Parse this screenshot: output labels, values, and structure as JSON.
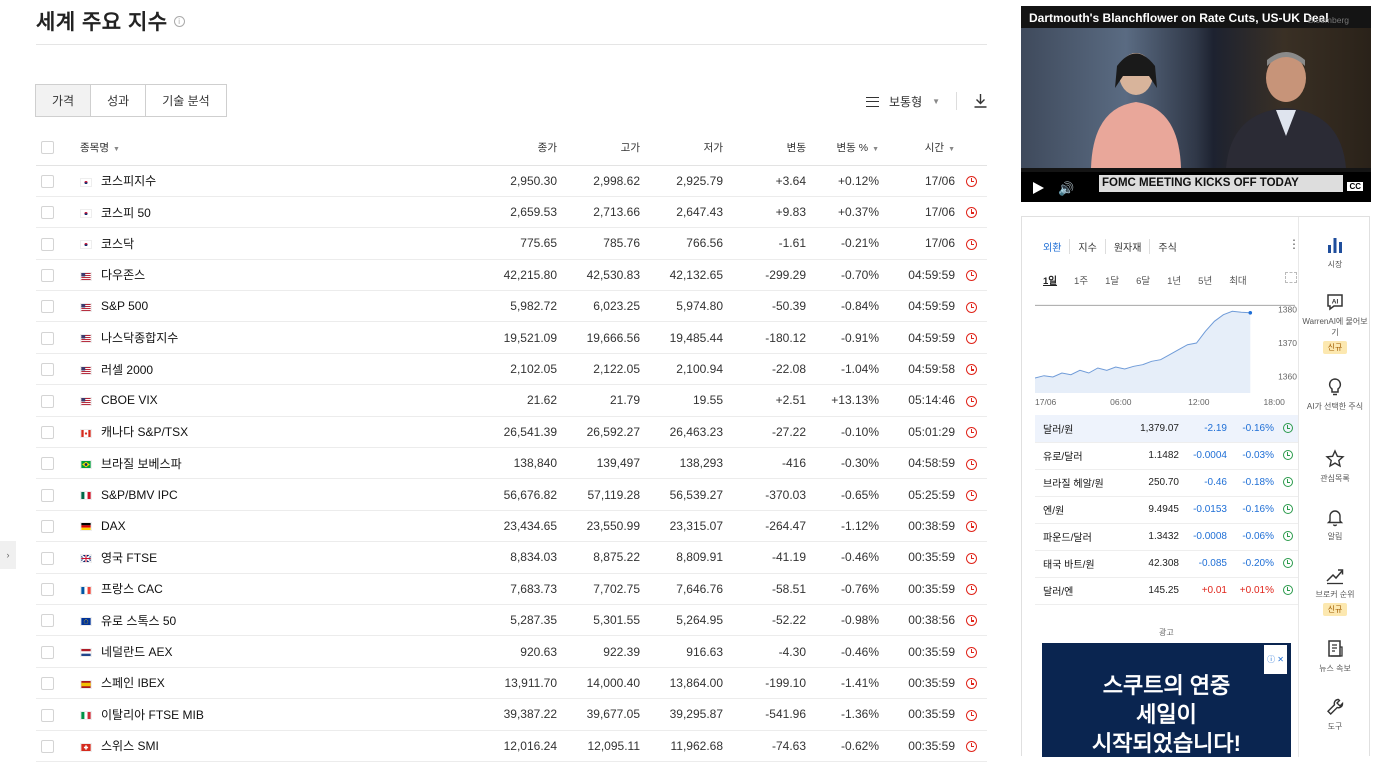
{
  "page_title": "세계 주요 지수",
  "tabs": [
    "가격",
    "성과",
    "기술 분석"
  ],
  "view_mode": "보통형",
  "columns": {
    "name": "종목명",
    "close": "종가",
    "high": "고가",
    "low": "저가",
    "change": "변동",
    "change_pct": "변동 %",
    "time": "시간"
  },
  "rows": [
    {
      "flag": "kr",
      "name": "코스피지수",
      "close": "2,950.30",
      "high": "2,998.62",
      "low": "2,925.79",
      "change": "+3.64",
      "change_pct": "+0.12%",
      "time": "17/06",
      "dir": "pos"
    },
    {
      "flag": "kr",
      "name": "코스피 50",
      "close": "2,659.53",
      "high": "2,713.66",
      "low": "2,647.43",
      "change": "+9.83",
      "change_pct": "+0.37%",
      "time": "17/06",
      "dir": "pos"
    },
    {
      "flag": "kr",
      "name": "코스닥",
      "close": "775.65",
      "high": "785.76",
      "low": "766.56",
      "change": "-1.61",
      "change_pct": "-0.21%",
      "time": "17/06",
      "dir": "neg"
    },
    {
      "flag": "us",
      "name": "다우존스",
      "close": "42,215.80",
      "high": "42,530.83",
      "low": "42,132.65",
      "change": "-299.29",
      "change_pct": "-0.70%",
      "time": "04:59:59",
      "dir": "neg"
    },
    {
      "flag": "us",
      "name": "S&P 500",
      "close": "5,982.72",
      "high": "6,023.25",
      "low": "5,974.80",
      "change": "-50.39",
      "change_pct": "-0.84%",
      "time": "04:59:59",
      "dir": "neg"
    },
    {
      "flag": "us",
      "name": "나스닥종합지수",
      "close": "19,521.09",
      "high": "19,666.56",
      "low": "19,485.44",
      "change": "-180.12",
      "change_pct": "-0.91%",
      "time": "04:59:59",
      "dir": "neg"
    },
    {
      "flag": "us",
      "name": "러셀 2000",
      "close": "2,102.05",
      "high": "2,122.05",
      "low": "2,100.94",
      "change": "-22.08",
      "change_pct": "-1.04%",
      "time": "04:59:58",
      "dir": "neg"
    },
    {
      "flag": "us",
      "name": "CBOE VIX",
      "close": "21.62",
      "high": "21.79",
      "low": "19.55",
      "change": "+2.51",
      "change_pct": "+13.13%",
      "time": "05:14:46",
      "dir": "pos"
    },
    {
      "flag": "ca",
      "name": "캐나다 S&P/TSX",
      "close": "26,541.39",
      "high": "26,592.27",
      "low": "26,463.23",
      "change": "-27.22",
      "change_pct": "-0.10%",
      "time": "05:01:29",
      "dir": "neg"
    },
    {
      "flag": "br",
      "name": "브라질 보베스파",
      "close": "138,840",
      "high": "139,497",
      "low": "138,293",
      "change": "-416",
      "change_pct": "-0.30%",
      "time": "04:58:59",
      "dir": "neg"
    },
    {
      "flag": "mx",
      "name": "S&P/BMV IPC",
      "close": "56,676.82",
      "high": "57,119.28",
      "low": "56,539.27",
      "change": "-370.03",
      "change_pct": "-0.65%",
      "time": "05:25:59",
      "dir": "neg"
    },
    {
      "flag": "de",
      "name": "DAX",
      "close": "23,434.65",
      "high": "23,550.99",
      "low": "23,315.07",
      "change": "-264.47",
      "change_pct": "-1.12%",
      "time": "00:38:59",
      "dir": "neg"
    },
    {
      "flag": "gb",
      "name": "영국 FTSE",
      "close": "8,834.03",
      "high": "8,875.22",
      "low": "8,809.91",
      "change": "-41.19",
      "change_pct": "-0.46%",
      "time": "00:35:59",
      "dir": "neg"
    },
    {
      "flag": "fr",
      "name": "프랑스 CAC",
      "close": "7,683.73",
      "high": "7,702.75",
      "low": "7,646.76",
      "change": "-58.51",
      "change_pct": "-0.76%",
      "time": "00:35:59",
      "dir": "neg"
    },
    {
      "flag": "eu",
      "name": "유로 스톡스 50",
      "close": "5,287.35",
      "high": "5,301.55",
      "low": "5,264.95",
      "change": "-52.22",
      "change_pct": "-0.98%",
      "time": "00:38:56",
      "dir": "neg"
    },
    {
      "flag": "nl",
      "name": "네덜란드 AEX",
      "close": "920.63",
      "high": "922.39",
      "low": "916.63",
      "change": "-4.30",
      "change_pct": "-0.46%",
      "time": "00:35:59",
      "dir": "neg"
    },
    {
      "flag": "es",
      "name": "스페인 IBEX",
      "close": "13,911.70",
      "high": "14,000.40",
      "low": "13,864.00",
      "change": "-199.10",
      "change_pct": "-1.41%",
      "time": "00:35:59",
      "dir": "neg"
    },
    {
      "flag": "it",
      "name": "이탈리아 FTSE MIB",
      "close": "39,387.22",
      "high": "39,677.05",
      "low": "39,295.87",
      "change": "-541.96",
      "change_pct": "-1.36%",
      "time": "00:35:59",
      "dir": "neg"
    },
    {
      "flag": "ch",
      "name": "스위스 SMI",
      "close": "12,016.24",
      "high": "12,095.11",
      "low": "11,962.68",
      "change": "-74.63",
      "change_pct": "-0.62%",
      "time": "00:35:59",
      "dir": "neg"
    }
  ],
  "video": {
    "title": "Dartmouth's Blanchflower on Rate Cuts, US-UK Deal",
    "brand": "Bloomberg",
    "ticker": "FOMC MEETING KICKS OFF TODAY",
    "cc": "CC"
  },
  "market_tabs": [
    "외환",
    "지수",
    "원자재",
    "주식"
  ],
  "periods": [
    "1일",
    "1주",
    "1달",
    "6달",
    "1년",
    "5년",
    "최대"
  ],
  "chart_data": {
    "type": "line",
    "x_ticks": [
      "17/06",
      "06:00",
      "12:00",
      "18:00"
    ],
    "y_ticks": [
      1360,
      1370,
      1380
    ],
    "ylim": [
      1355,
      1382
    ],
    "x": [
      0,
      1,
      2,
      3,
      4,
      5,
      6,
      7,
      8,
      9,
      10,
      11,
      12,
      13,
      14,
      15,
      16,
      17,
      18,
      19,
      20,
      21,
      22,
      23,
      24
    ],
    "values": [
      1359.5,
      1360.2,
      1359.8,
      1361.0,
      1360.5,
      1361.8,
      1361.0,
      1362.5,
      1361.8,
      1362.8,
      1362.2,
      1363.0,
      1363.5,
      1364.5,
      1365.0,
      1366.5,
      1368.0,
      1369.5,
      1370.0,
      1373.5,
      1376.5,
      1378.5,
      1379.5,
      1379.2,
      1379.07
    ],
    "grid": false
  },
  "fx_rows": [
    {
      "name": "달러/원",
      "price": "1,379.07",
      "change": "-2.19",
      "change_pct": "-0.16%",
      "dir": "neg",
      "selected": true
    },
    {
      "name": "유로/달러",
      "price": "1.1482",
      "change": "-0.0004",
      "change_pct": "-0.03%",
      "dir": "neg"
    },
    {
      "name": "브라질 헤알/원",
      "price": "250.70",
      "change": "-0.46",
      "change_pct": "-0.18%",
      "dir": "neg"
    },
    {
      "name": "엔/원",
      "price": "9.4945",
      "change": "-0.0153",
      "change_pct": "-0.16%",
      "dir": "neg"
    },
    {
      "name": "파운드/달러",
      "price": "1.3432",
      "change": "-0.0008",
      "change_pct": "-0.06%",
      "dir": "neg"
    },
    {
      "name": "태국 바트/원",
      "price": "42.308",
      "change": "-0.085",
      "change_pct": "-0.20%",
      "dir": "neg"
    },
    {
      "name": "달러/엔",
      "price": "145.25",
      "change": "+0.01",
      "change_pct": "+0.01%",
      "dir": "pos"
    }
  ],
  "ad": {
    "label": "광고",
    "line1": "스쿠트의 연중",
    "line2": "세일이",
    "line3": "시작되었습니다!"
  },
  "sidebar": [
    {
      "label": "시장",
      "icon": "bar-chart-icon"
    },
    {
      "label": "WarrenAI에 물어보기",
      "icon": "ai-icon",
      "badge": "신규"
    },
    {
      "label": "AI가 선택한 주식",
      "icon": "lightbulb-icon"
    },
    {
      "label": "관심목록",
      "icon": "star-icon"
    },
    {
      "label": "알림",
      "icon": "bell-icon"
    },
    {
      "label": "브로커 순위",
      "icon": "trend-up-icon",
      "badge": "신규"
    },
    {
      "label": "뉴스 속보",
      "icon": "news-icon"
    },
    {
      "label": "도구",
      "icon": "wrench-icon"
    }
  ],
  "colors": {
    "up": "#e0251b",
    "down": "#1f6fd6",
    "accent": "#1f6fd6",
    "clock_green": "#2a9a4b"
  }
}
